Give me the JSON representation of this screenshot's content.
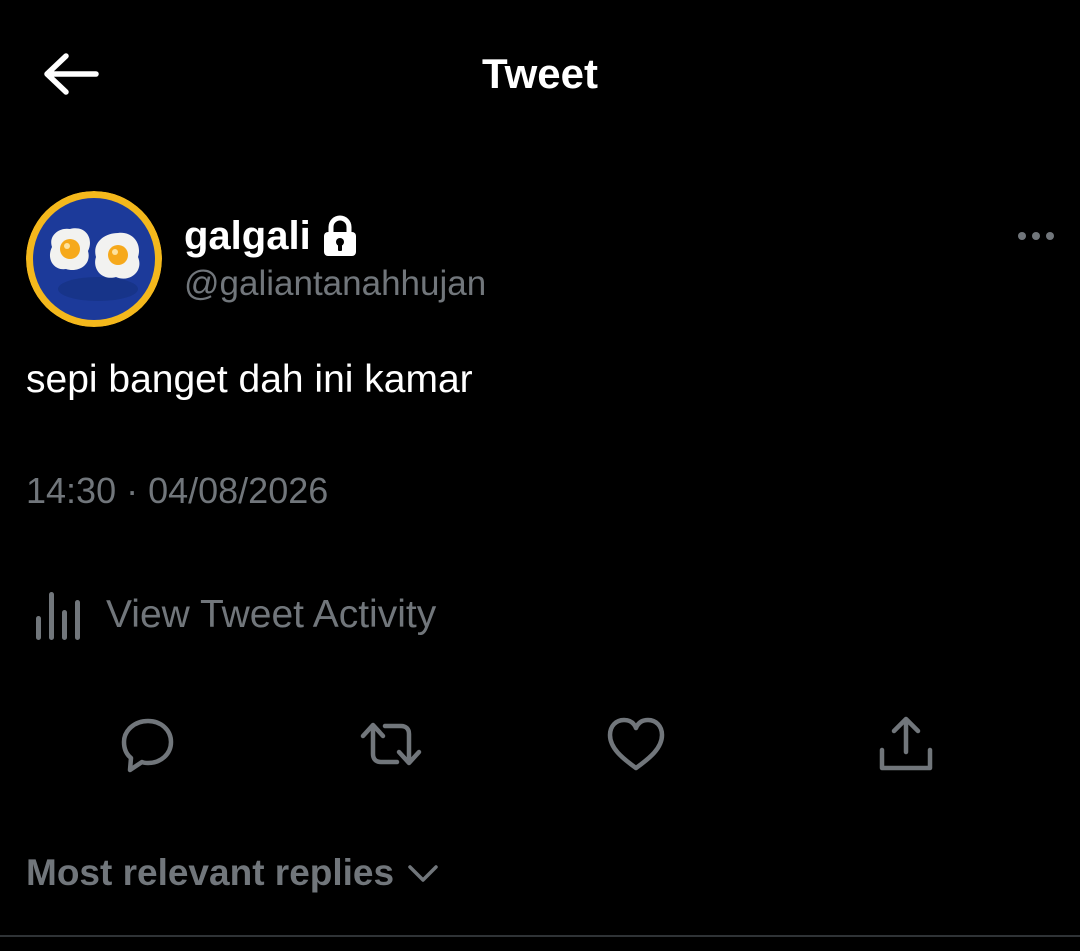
{
  "header": {
    "title": "Tweet"
  },
  "author": {
    "display_name": "galgali",
    "handle": "@galiantanahhujan",
    "protected": true
  },
  "tweet": {
    "text": "sepi banget dah ini kamar",
    "timestamp": "14:30 · 04/08/2026"
  },
  "activity": {
    "label": "View Tweet Activity"
  },
  "actions": [
    {
      "icon": "reply-icon"
    },
    {
      "icon": "retweet-icon"
    },
    {
      "icon": "like-icon"
    },
    {
      "icon": "share-icon"
    }
  ],
  "replies": {
    "sort_label": "Most relevant replies"
  },
  "colors": {
    "background": "#000000",
    "text_primary": "#ffffff",
    "text_secondary": "#71767b",
    "avatar_ring": "#f4b81c",
    "avatar_plate": "#1c3a9a"
  }
}
